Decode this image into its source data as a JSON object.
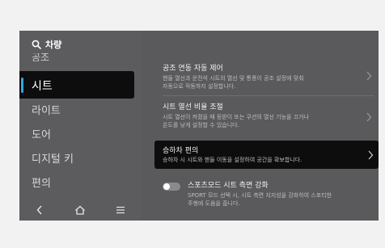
{
  "search": {
    "label": "차량"
  },
  "sidebar": {
    "items": [
      {
        "label": "공조",
        "state": "partially-hidden"
      },
      {
        "label": "시트",
        "state": "selected"
      },
      {
        "label": "라이트"
      },
      {
        "label": "도어"
      },
      {
        "label": "디지털 키"
      },
      {
        "label": "편의"
      }
    ],
    "accent_color": "#2fa7e8"
  },
  "bottom_nav": {
    "icons": [
      "back-chevron-icon",
      "home-icon",
      "menu-icon"
    ]
  },
  "settings": [
    {
      "title": "공조 연동 자동 제어",
      "desc": [
        "핸들 열선과 운전석 시트의 열선 및 통풍이 공조 설정에 맞춰",
        "자동으로 작동하지 설정합니다."
      ]
    },
    {
      "title": "시트 열선 비율 조절",
      "desc": [
        "시트 열선이 켜졌을 때 등받이 또는 쿠션의 열선 기능을 끄거나",
        "온도를 낮게 설정할 수 있습니다."
      ]
    },
    {
      "title": "승하차 편의",
      "desc": [
        "승하차 시 시트와 핸들 이동을 설정하여 공간을 확보합니다."
      ],
      "state": "focused"
    },
    {
      "title": "스포츠모드 시트 측면 강화",
      "desc": [
        "SPORT 모드 선택 시, 시트 측면 지지성을 강화하여 스포티한",
        "주행에 도움을 줍니다."
      ],
      "toggle": "off"
    }
  ]
}
